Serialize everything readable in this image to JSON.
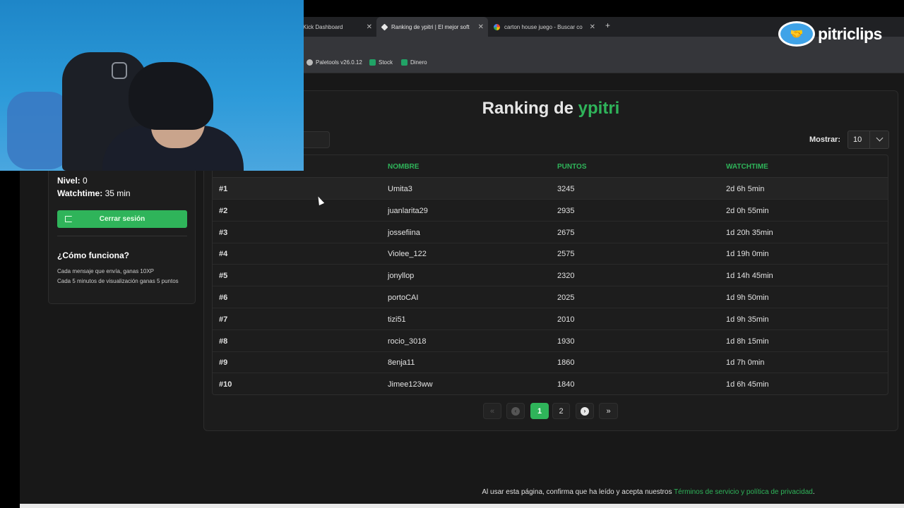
{
  "browser": {
    "tabs": [
      {
        "label": "Kick Dashboard",
        "close": "✕"
      },
      {
        "label": "Ranking de ypitri | El mejor soft",
        "close": "✕"
      },
      {
        "label": "carton house juego - Buscar co",
        "close": "✕"
      }
    ],
    "new_tab": "+",
    "bookmarks": [
      {
        "label": "Paletools v26.0.12"
      },
      {
        "label": "Stock"
      },
      {
        "label": "Dinero"
      }
    ]
  },
  "brand": {
    "text": "pitriclips"
  },
  "title": {
    "prefix": "Ranking de",
    "highlight": "ypitri"
  },
  "sidebar": {
    "nivel_label": "Nivel:",
    "nivel_value": "0",
    "watchtime_label": "Watchtime:",
    "watchtime_value": "35 min",
    "logout_label": "Cerrar sesión",
    "how_title": "¿Cómo funciona?",
    "how_line1": "Cada mensaje que envía, ganas 10XP",
    "how_line2": "Cada 5 minutos de visualización ganas 5 puntos"
  },
  "controls": {
    "show_label": "Mostrar:",
    "show_value": "10"
  },
  "table": {
    "headers": {
      "nombre": "NOMBRE",
      "puntos": "PUNTOS",
      "watchtime": "WATCHTIME"
    },
    "rows": [
      {
        "rank": "#1",
        "name": "Umita3",
        "points": "3245",
        "watchtime": "2d 6h 5min"
      },
      {
        "rank": "#2",
        "name": "juanlarita29",
        "points": "2935",
        "watchtime": "2d 0h 55min"
      },
      {
        "rank": "#3",
        "name": "jossefiina",
        "points": "2675",
        "watchtime": "1d 20h 35min"
      },
      {
        "rank": "#4",
        "name": "Violee_122",
        "points": "2575",
        "watchtime": "1d 19h 0min"
      },
      {
        "rank": "#5",
        "name": "jonyllop",
        "points": "2320",
        "watchtime": "1d 14h 45min"
      },
      {
        "rank": "#6",
        "name": "portoCAI",
        "points": "2025",
        "watchtime": "1d 9h 50min"
      },
      {
        "rank": "#7",
        "name": "tizi51",
        "points": "2010",
        "watchtime": "1d 9h 35min"
      },
      {
        "rank": "#8",
        "name": "rocio_3018",
        "points": "1930",
        "watchtime": "1d 8h 15min"
      },
      {
        "rank": "#9",
        "name": "8enja11",
        "points": "1860",
        "watchtime": "1d 7h 0min"
      },
      {
        "rank": "#10",
        "name": "Jimee123ww",
        "points": "1840",
        "watchtime": "1d 6h 45min"
      }
    ]
  },
  "pagination": {
    "first": "«",
    "prev": "‹",
    "pages": [
      "1",
      "2"
    ],
    "next": "›",
    "last": "»"
  },
  "footer": {
    "text": "Al usar esta página, confirma que ha leído y acepta nuestros",
    "link": "Términos de servicio y política de privacidad",
    "end": "."
  },
  "colors": {
    "accent": "#2fb45a",
    "background": "#181818",
    "card": "#1c1c1c"
  }
}
